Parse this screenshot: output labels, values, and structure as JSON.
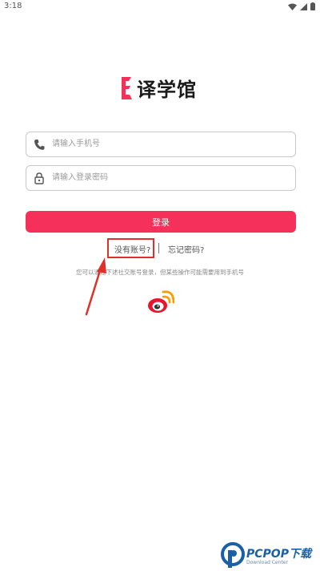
{
  "status_bar": {
    "time": "3:18"
  },
  "logo": {
    "text": "译学馆"
  },
  "phone_field": {
    "placeholder": "请输入手机号",
    "value": ""
  },
  "password_field": {
    "placeholder": "请输入登录密码",
    "value": ""
  },
  "login_button": {
    "label": "登录"
  },
  "links": {
    "no_account": "没有账号?",
    "separator": "|",
    "forgot_password": "忘记密码?"
  },
  "social_hint": "您可以通过下述社交账号登录，但某些操作可能需要用到手机号",
  "social_icons": [
    "weibo-icon"
  ],
  "watermark": {
    "brand": "PCPOP下载",
    "sub": "Download Center"
  },
  "colors": {
    "accent": "#f5305a",
    "highlight_box": "#e0302a",
    "arrow": "#e0302a"
  }
}
